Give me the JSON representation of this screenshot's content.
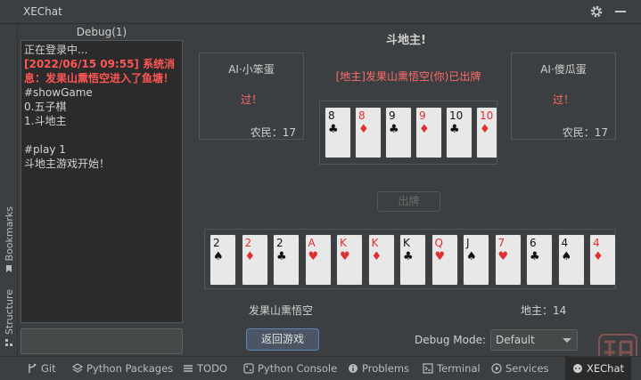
{
  "window": {
    "title": "XEChat"
  },
  "left_tabs": {
    "bookmarks": "Bookmarks",
    "structure": "Structure"
  },
  "debug": {
    "title": "Debug(1)",
    "log_lines": [
      {
        "text": "正在登录中...",
        "red": false
      },
      {
        "text": "[2022/06/15 09:55] 系统消息：发果山熏悟空进入了鱼塘！",
        "red": true
      },
      {
        "text": "#showGame",
        "red": false
      },
      {
        "text": "0.五子棋",
        "red": false
      },
      {
        "text": "1.斗地主",
        "red": false
      },
      {
        "text": "",
        "red": false
      },
      {
        "text": "#play 1",
        "red": false
      },
      {
        "text": "斗地主游戏开始！",
        "red": false
      }
    ]
  },
  "game": {
    "title": "斗地主!",
    "ai_left": {
      "name": "AI·小笨蛋",
      "status": "过！",
      "role": "农民：17"
    },
    "ai_right": {
      "name": "AI·傻瓜蛋",
      "status": "过！",
      "role": "农民：17"
    },
    "announcement": "[地主]发果山熏悟空(你)已出牌",
    "played_cards": [
      {
        "rank": "8",
        "suit": "♣",
        "red": false
      },
      {
        "rank": "8",
        "suit": "♦",
        "red": true
      },
      {
        "rank": "9",
        "suit": "♣",
        "red": false
      },
      {
        "rank": "9",
        "suit": "♦",
        "red": true
      },
      {
        "rank": "10",
        "suit": "♣",
        "red": false
      },
      {
        "rank": "10",
        "suit": "♦",
        "red": true
      }
    ],
    "play_button": "出牌",
    "hand_cards": [
      {
        "rank": "2",
        "suit": "♠",
        "red": false
      },
      {
        "rank": "2",
        "suit": "♦",
        "red": true
      },
      {
        "rank": "2",
        "suit": "♣",
        "red": false
      },
      {
        "rank": "A",
        "suit": "♥",
        "red": true
      },
      {
        "rank": "K",
        "suit": "♥",
        "red": true
      },
      {
        "rank": "K",
        "suit": "♦",
        "red": true
      },
      {
        "rank": "K",
        "suit": "♣",
        "red": false
      },
      {
        "rank": "Q",
        "suit": "♥",
        "red": true
      },
      {
        "rank": "J",
        "suit": "♠",
        "red": false
      },
      {
        "rank": "7",
        "suit": "♥",
        "red": true
      },
      {
        "rank": "6",
        "suit": "♣",
        "red": false
      },
      {
        "rank": "4",
        "suit": "♠",
        "red": false
      },
      {
        "rank": "4",
        "suit": "♦",
        "red": true
      }
    ],
    "player_name": "发果山熏悟空",
    "player_role": "地主：14",
    "back_button": "返回游戏",
    "debug_mode_label": "Debug Mode:",
    "debug_mode_value": "Default"
  },
  "bottom_tabs": [
    {
      "label": "Git",
      "icon": "git-branch-icon"
    },
    {
      "label": "Python Packages",
      "icon": "layers-icon"
    },
    {
      "label": "TODO",
      "icon": "list-icon"
    },
    {
      "label": "Python Console",
      "icon": "python-icon"
    },
    {
      "label": "Problems",
      "icon": "info-icon"
    },
    {
      "label": "Terminal",
      "icon": "terminal-icon"
    },
    {
      "label": "Services",
      "icon": "play-icon"
    },
    {
      "label": "XEChat",
      "icon": "chat-icon"
    }
  ]
}
